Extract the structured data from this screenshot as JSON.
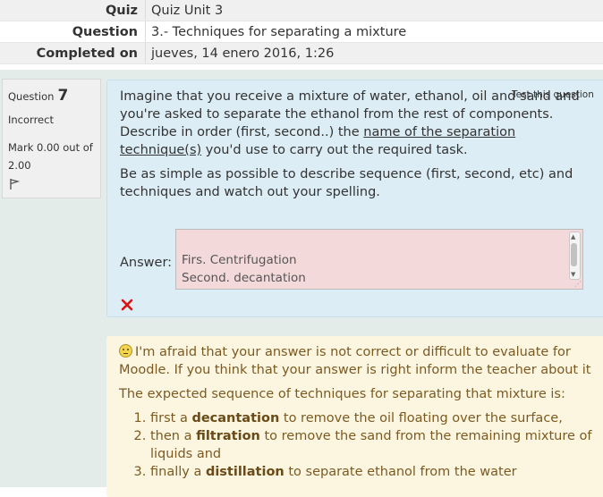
{
  "summary": {
    "quiz_label": "Quiz",
    "quiz_value": "Quiz Unit 3",
    "question_label": "Question",
    "question_value": "3.- Techniques for separating a mixture",
    "completed_label": "Completed on",
    "completed_value": "jueves, 14 enero 2016, 1:26"
  },
  "info": {
    "question_word": "Question",
    "question_number": "7",
    "state": "Incorrect",
    "mark_text": "Mark 0.00 out of 2.00",
    "flag_icon": "flag-icon"
  },
  "question": {
    "test_link": "Test this question",
    "para1_a": "Imagine that you receive a mixture of water, ethanol, oil and sand and you're asked to separate the ethanol from the rest of components. Describe in order (first, second..) the ",
    "para1_u": "name of the separation technique(s)",
    "para1_b": " you'd use to carry out the required task.",
    "para2": "Be as simple as possible to describe sequence (first, second, etc) and techniques and watch out your spelling.",
    "answer_label": "Answer:",
    "answer_value": "Firs. Centrifugation\nSecond. decantation\nThird. distillation",
    "incorrect_icon": "cross-icon",
    "incorrect_color": "#e01010"
  },
  "feedback": {
    "intro": "I'm afraid that your answer is not correct or difficult to evaluate for Moodle. If you think that your answer is right inform the teacher about it",
    "expected_intro": "The expected sequence of techniques for separating that mixture is:",
    "steps": [
      {
        "pre": "first a ",
        "bold": "decantation",
        "post": " to remove the oil floating over the surface,"
      },
      {
        "pre": "then a ",
        "bold": "filtration",
        "post": " to remove the sand from the remaining mixture of liquids and"
      },
      {
        "pre": "finally a ",
        "bold": "distillation",
        "post": " to separate ethanol from the water"
      }
    ]
  }
}
